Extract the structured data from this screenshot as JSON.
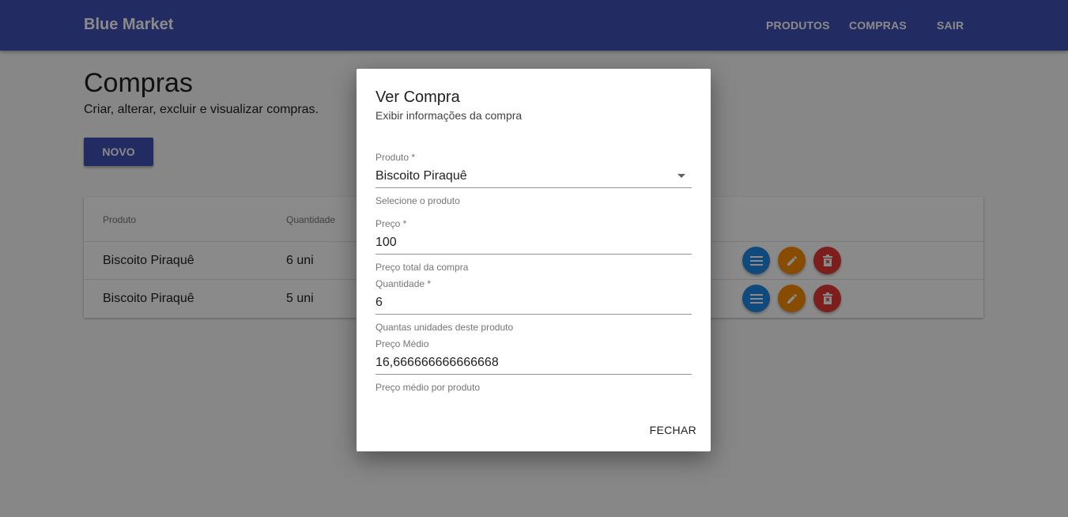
{
  "appbar": {
    "brand": "Blue Market",
    "nav": [
      "PRODUTOS",
      "COMPRAS",
      "SAIR"
    ]
  },
  "page": {
    "title": "Compras",
    "subtitle": "Criar, alterar, excluir e visualizar compras.",
    "new_button": "NOVO"
  },
  "table": {
    "headers": [
      "Produto",
      "Quantidade"
    ],
    "rows": [
      {
        "produto": "Biscoito Piraquê",
        "quantidade": "6 uni"
      },
      {
        "produto": "Biscoito Piraquê",
        "quantidade": "5 uni"
      }
    ],
    "row_actions": [
      "list-icon",
      "pencil-icon",
      "trash-icon"
    ]
  },
  "dialog": {
    "title": "Ver Compra",
    "subtitle": "Exibir informações da compra",
    "fields": [
      {
        "label": "Produto *",
        "value": "Biscoito Piraquê",
        "help": "Selecione o produto"
      },
      {
        "label": "Preço *",
        "value": "100",
        "help": "Preço total da compra"
      },
      {
        "label": "Quantidade *",
        "value": "6",
        "help": "Quantas unidades deste produto"
      },
      {
        "label": "Preço Médio",
        "value": "16,666666666666668",
        "help": "Preço médio por produto"
      }
    ],
    "close_button": "FECHAR"
  },
  "colors": {
    "primary": "#3f51b5",
    "view": "#1e88e5",
    "edit": "#fb8c00",
    "delete": "#e53935"
  }
}
